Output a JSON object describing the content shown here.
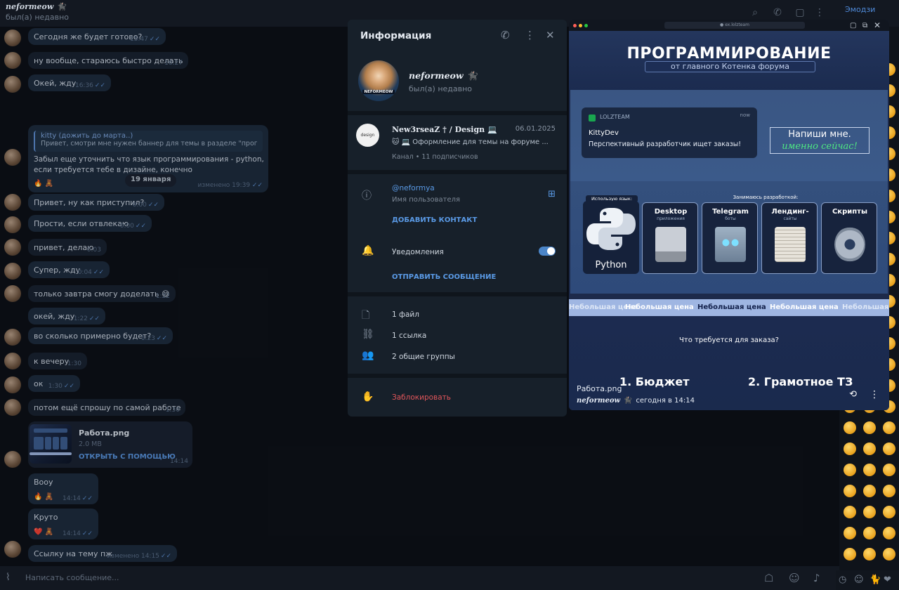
{
  "header": {
    "name": "neformeow 🐈‍⬛",
    "status": "был(а) недавно",
    "emoji_tab": "Эмодзи"
  },
  "messages": [
    {
      "text": "Сегодня же будет готово?",
      "time": "15:47"
    },
    {
      "text": "ну вообще, стараюсь быстро делать",
      "time": "16:27"
    },
    {
      "text": "Окей, жду",
      "time": "16:36"
    },
    {
      "quote_author": "kitty (дожить до марта..)",
      "quote_text": "Привет, смотри мне нужен баннер для темы в разделе \"прог...",
      "text": "Забыл еще уточнить что язык программирования - python, если требуется тебе в дизайне, конечно",
      "time": "изменено 19:39",
      "reactions": "🔥 🧸"
    },
    {
      "text": "Привет, ну как приступил?",
      "time": "0:00"
    },
    {
      "text": "Прости, если отвлекаю",
      "time": "0:00"
    },
    {
      "text": "привет, делаю",
      "time": "0:03"
    },
    {
      "text": "Супер, жду",
      "time": "0:04"
    },
    {
      "text": "только завтра смогу доделать 😅",
      "time": "1:22"
    },
    {
      "text": "окей, жду",
      "time": "1:22"
    },
    {
      "text": "во сколько примерно будет?",
      "time": "1:23"
    },
    {
      "text": "к вечеру",
      "time": "1:30"
    },
    {
      "text": "ок",
      "time": "1:30"
    },
    {
      "text": "потом ещё спрошу по самой работе",
      "time": "1:30"
    },
    {
      "text": "Вооу",
      "time": "14:14",
      "reactions": "🔥 🧸"
    },
    {
      "text": "Круто",
      "time": "14:14",
      "reactions": "❤️ 🧸"
    },
    {
      "text": "Ссылку на тему пж",
      "time": "изменено 14:15"
    }
  ],
  "day_badge": "19 января",
  "file_message": {
    "name": "Работа.png",
    "size": "2.0 MB",
    "action": "ОТКРЫТЬ С ПОМОЩЬЮ",
    "time": "14:14"
  },
  "compose": {
    "placeholder": "Написать сообщение..."
  },
  "info_panel": {
    "title": "Информация",
    "profile_name": "neformeow 🐈‍⬛",
    "profile_status": "был(а) недавно",
    "avatar_badge": "NEFORMEOW",
    "channel": {
      "logo_text": "design",
      "name": "New3rseaZ † / Design 💻",
      "date": "06.01.2025",
      "desc": "🐱 💻 Оформление для темы на форуме ...",
      "meta": "Канал • 11 подписчиков"
    },
    "username": "@neformya",
    "username_label": "Имя пользователя",
    "add_contact": "ДОБАВИТЬ КОНТАКТ",
    "notifications": "Уведомления",
    "send_message": "ОТПРАВИТЬ СООБЩЕНИЕ",
    "files": "1 файл",
    "links": "1 ссылка",
    "groups": "2 общие группы",
    "block": "Заблокировать"
  },
  "viewer": {
    "url": "● ex.lolzteam",
    "banner_title": "ПРОГРАММИРОВАНИЕ",
    "banner_sub": "от главного Котенка форума",
    "notif_app": "LOLZTEAM",
    "notif_time": "now",
    "notif_from": "KittyDev",
    "notif_msg": "Перспективный разработчик ищет заказы!",
    "write_me": "Напиши мне.",
    "write_me_script": "именно сейчас!",
    "lang_caption": "Использую язык:",
    "dev_caption": "Занимаюсь разработкой:",
    "python_label": "Python",
    "cards": [
      {
        "title": "Desktop",
        "sub": "приложения"
      },
      {
        "title": "Telegram",
        "sub": "боты"
      },
      {
        "title": "Лендинг-",
        "sub": "сайты"
      },
      {
        "title": "Скрипты",
        "sub": ""
      }
    ],
    "ticker": [
      "Небольшая цена",
      "Небольшая цена",
      "Небольшая цена",
      "Небольшая цена",
      "Небольшая цена"
    ],
    "question": "Что требуется для заказа?",
    "point1": "1. Бюджет",
    "point2": "2. Грамотное ТЗ",
    "file_caption": "Работа.png",
    "author": "neformeow 🐈‍⬛",
    "author_time": "сегодня в 14:14"
  }
}
